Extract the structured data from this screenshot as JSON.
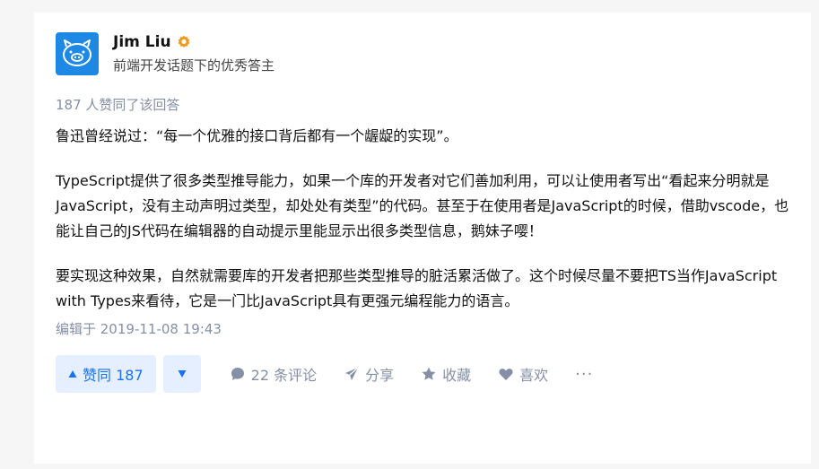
{
  "author": {
    "name": "Jim Liu",
    "headline": "前端开发话题下的优秀答主",
    "avatar_icon": "pig-icon",
    "badge_icon": "excellent-answerer-badge-icon",
    "badge_color": "#f09a1a",
    "avatar_color": "#1e88e5"
  },
  "answer": {
    "vote_summary": "187 人赞同了该回答",
    "paragraphs": [
      "鲁迅曾经说过：“每一个优雅的接口背后都有一个龌龊的实现”。",
      "TypeScript提供了很多类型推导能力，如果一个库的开发者对它们善加利用，可以让使用者写出“看起来分明就是JavaScript，没有主动声明过类型，却处处有类型”的代码。甚至于在使用者是JavaScript的时候，借助vscode，也能让自己的JS代码在编辑器的自动提示里能显示出很多类型信息，鹅妹子嘤！",
      "要实现这种效果，自然就需要库的开发者把那些类型推导的脏活累活做了。这个时候尽量不要把TS当作JavaScript with Types来看待，它是一门比JavaScript具有更强元编程能力的语言。"
    ],
    "edit_time": "编辑于 2019-11-08 19:43"
  },
  "actions": {
    "upvote_label": "赞同 187",
    "comments_label": "22 条评论",
    "share_label": "分享",
    "favorite_label": "收藏",
    "like_label": "喜欢",
    "more_label": "···",
    "accent_color": "#1772f6",
    "muted_color": "#8590a6"
  }
}
